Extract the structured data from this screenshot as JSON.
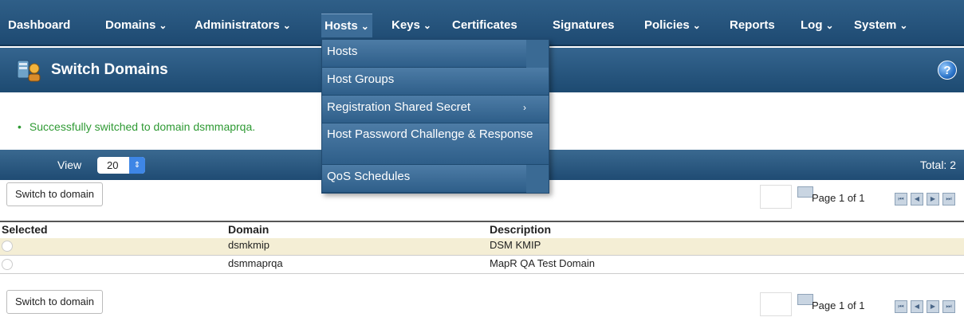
{
  "nav": {
    "items": [
      "Dashboard",
      "Domains",
      "Administrators",
      "Hosts",
      "Keys",
      "Certificates",
      "Signatures",
      "Policies",
      "Reports",
      "Log",
      "System"
    ],
    "caret": "⌄"
  },
  "title": "Switch Domains",
  "help": "?",
  "message": "Successfully switched to domain dsmmaprqa.",
  "view": {
    "label": "View",
    "value": "20",
    "total": "Total: 2"
  },
  "switch_button": "Switch to domain",
  "pager": {
    "text": "Page 1 of 1",
    "buttons": [
      "⏮",
      "◀",
      "▶",
      "⏭"
    ]
  },
  "table": {
    "columns": [
      "Selected",
      "Domain",
      "Description"
    ],
    "rows": [
      {
        "domain": "dsmkmip",
        "description": "DSM KMIP"
      },
      {
        "domain": "dsmmaprqa",
        "description": "MapR QA Test Domain"
      }
    ]
  },
  "hosts_menu": {
    "items": [
      "Hosts",
      "Host Groups",
      "Registration Shared Secret",
      "Host Password Challenge & Response",
      "QoS Schedules"
    ],
    "submenu_arrow": "›"
  },
  "colors": {
    "nav_bg": "#1e4a72",
    "success": "#2f9a34",
    "row_highlight": "#f4eed5"
  }
}
